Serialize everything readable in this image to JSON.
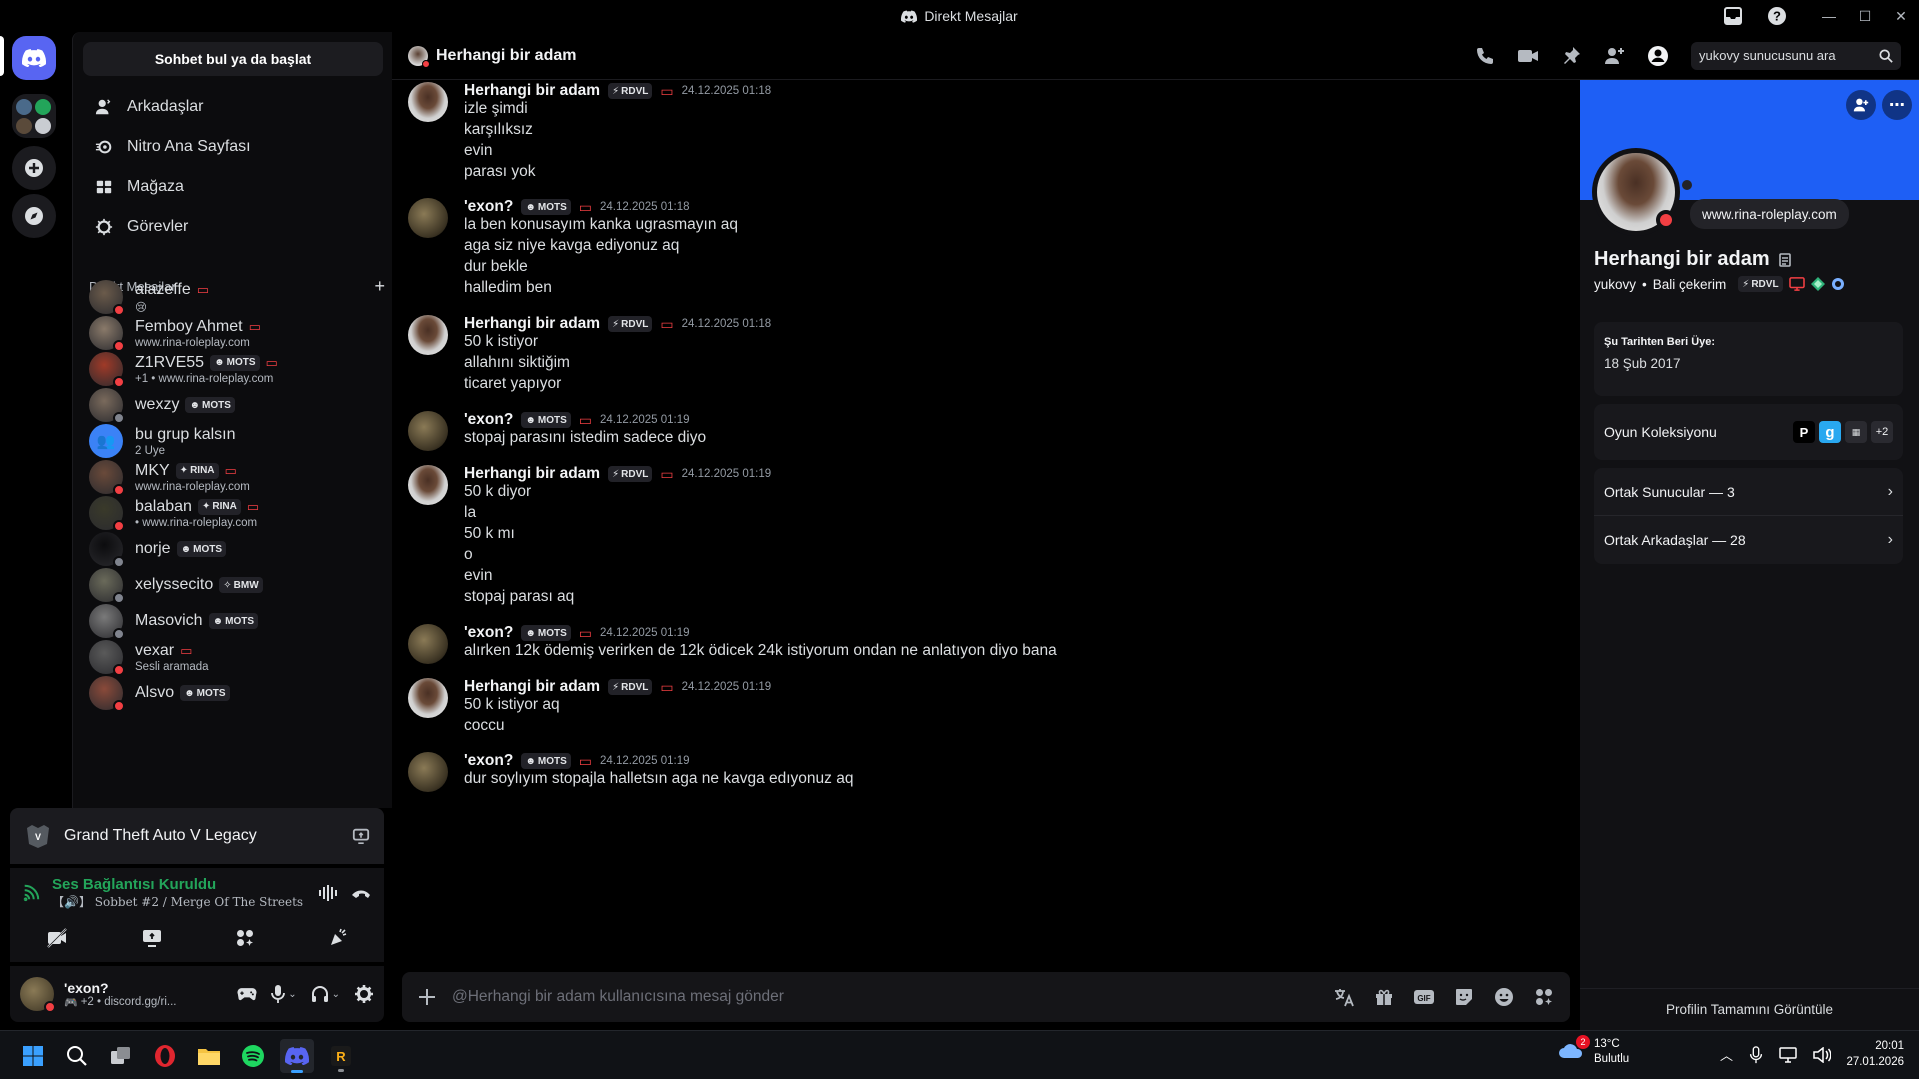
{
  "window": {
    "title": "Direkt Mesajlar"
  },
  "sidebar": {
    "search_label": "Sohbet bul ya da başlat",
    "nav": [
      {
        "label": "Arkadaşlar",
        "icon": "friends-icon"
      },
      {
        "label": "Nitro Ana Sayfası",
        "icon": "nitro-icon"
      },
      {
        "label": "Mağaza",
        "icon": "shop-icon"
      },
      {
        "label": "Görevler",
        "icon": "quests-icon"
      }
    ],
    "dm_header": "Direkt Mesajlar",
    "dms": [
      {
        "name": "alazeffe",
        "sub": "😢",
        "tag": "",
        "status": "dnd",
        "color": "#6b5b4b"
      },
      {
        "name": "Femboy Ahmet",
        "sub": "www.rina-roleplay.com",
        "tag": "",
        "status": "dnd",
        "color": "#8a7a6a"
      },
      {
        "name": "Z1RVE55",
        "sub": "+1 • www.rina-roleplay.com",
        "tag": "MOTS",
        "status": "dnd",
        "color": "#a03a28"
      },
      {
        "name": "wexzy",
        "sub": "",
        "tag": "MOTS",
        "status": "offline",
        "color": "#7a6a5c"
      },
      {
        "name": "bu grup kalsın",
        "sub": "2 Üye",
        "tag": "",
        "status": "",
        "color": "#3b82f6"
      },
      {
        "name": "MKY",
        "sub": "www.rina-roleplay.com",
        "tag": "RINA",
        "status": "dnd",
        "color": "#6a4a3a"
      },
      {
        "name": "balaban",
        "sub": "• www.rina-roleplay.com",
        "tag": "RINA",
        "status": "dnd",
        "color": "#3a3a2a"
      },
      {
        "name": "norje",
        "sub": "",
        "tag": "MOTS",
        "status": "offline",
        "color": "#0c0c0e"
      },
      {
        "name": "xelyssecito",
        "sub": "",
        "tag": "BMW",
        "status": "offline",
        "color": "#6a6a5a"
      },
      {
        "name": "Masovich",
        "sub": "",
        "tag": "MOTS",
        "status": "offline",
        "color": "#7a7a7a"
      },
      {
        "name": "vexar",
        "sub": "Sesli aramada",
        "tag": "",
        "status": "dnd",
        "color": "#5a5a5a"
      },
      {
        "name": "Alsvo",
        "sub": "",
        "tag": "MOTS",
        "status": "dnd",
        "color": "#8a4a3a"
      }
    ]
  },
  "activity": {
    "game": "Grand Theft Auto V Legacy"
  },
  "voice": {
    "status": "Ses Bağlantısı Kuruldu",
    "channel": "【🔊】 Sobbet #2 / Merge Of The Streets"
  },
  "user": {
    "name": "'exon?",
    "status": "+2 • discord.gg/ri..."
  },
  "chat": {
    "recipient": "Herhangi bir adam",
    "search_placeholder": "yukovy sunucusunu ara",
    "composer_placeholder": "@Herhangi bir adam kullanıcısına mesaj gönder",
    "messages": [
      {
        "author": "Herhangi bir adam",
        "tag": "RDVL",
        "time": "24.12.2025 01:18",
        "lines": [
          "izle şimdi",
          "karşılıksız",
          "evin",
          "parası yok"
        ]
      },
      {
        "author": "'exon?",
        "tag": "MOTS",
        "time": "24.12.2025 01:18",
        "lines": [
          "la ben konusayım kanka ugrasmayın aq",
          "aga siz niye kavga ediyonuz aq",
          "dur bekle",
          "halledim ben"
        ]
      },
      {
        "author": "Herhangi bir adam",
        "tag": "RDVL",
        "time": "24.12.2025 01:18",
        "lines": [
          "50 k istiyor",
          "allahını siktiğim",
          "ticaret yapıyor"
        ]
      },
      {
        "author": "'exon?",
        "tag": "MOTS",
        "time": "24.12.2025 01:19",
        "lines": [
          "stopaj parasını istedim sadece diyo"
        ]
      },
      {
        "author": "Herhangi bir adam",
        "tag": "RDVL",
        "time": "24.12.2025 01:19",
        "lines": [
          "50 k diyor",
          "la",
          "50 k mı",
          "o",
          "evin",
          "stopaj parası aq"
        ]
      },
      {
        "author": "'exon?",
        "tag": "MOTS",
        "time": "24.12.2025 01:19",
        "lines": [
          "alırken 12k ödemiş verirken de 12k ödicek 24k istiyorum ondan ne anlatıyon diyo bana"
        ]
      },
      {
        "author": "Herhangi bir adam",
        "tag": "RDVL",
        "time": "24.12.2025 01:19",
        "lines": [
          "50 k istiyor aq",
          "coccu"
        ]
      },
      {
        "author": "'exon?",
        "tag": "MOTS",
        "time": "24.12.2025 01:19",
        "lines": [
          "dur soylıyım stopajla halletsın aga ne kavga edıyonuz aq"
        ]
      }
    ]
  },
  "profile": {
    "website": "www.rina-roleplay.com",
    "display_name": "Herhangi bir adam",
    "username": "yukovy",
    "pronoun": "Bali çekerim",
    "tag": "RDVL",
    "member_since_label": "Şu Tarihten Beri Üye:",
    "member_since": "18 Şub 2017",
    "game_collection": "Oyun Koleksiyonu",
    "game_more": "+2",
    "mutual_servers": "Ortak Sunucular — 3",
    "mutual_friends": "Ortak Arkadaşlar — 28",
    "view_full": "Profilin Tamamını Görüntüle"
  },
  "taskbar": {
    "temp": "13°C",
    "weather": "Bulutlu",
    "weather_badge": "2",
    "time": "20:01",
    "date": "27.01.2026"
  },
  "colors": {
    "dnd": "#f23f43",
    "offline": "#80848e",
    "accent": "#5865f2",
    "voice_green": "#23a55a",
    "banner": "#1e5ff5"
  }
}
